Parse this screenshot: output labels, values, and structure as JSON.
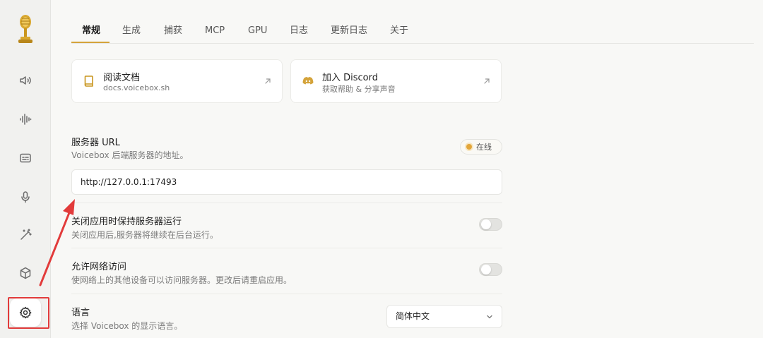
{
  "sidebar": {
    "items": [
      {
        "icon": "speaker-icon"
      },
      {
        "icon": "waveform-icon"
      },
      {
        "icon": "caption-icon"
      },
      {
        "icon": "microphone-icon"
      },
      {
        "icon": "magic-wand-icon"
      },
      {
        "icon": "cube-icon"
      },
      {
        "icon": "gear-icon",
        "active": true
      }
    ]
  },
  "tabs": [
    "常规",
    "生成",
    "捕获",
    "MCP",
    "GPU",
    "日志",
    "更新日志",
    "关于"
  ],
  "cards": [
    {
      "title": "阅读文档",
      "subtitle": "docs.voicebox.sh",
      "icon": "book-icon"
    },
    {
      "title": "加入 Discord",
      "subtitle": "获取帮助 & 分享声音",
      "icon": "discord-icon"
    }
  ],
  "server": {
    "label": "服务器 URL",
    "description": "Voicebox 后端服务器的地址。",
    "status": "在线",
    "url": "http://127.0.0.1:17493"
  },
  "keep_running": {
    "label": "关闭应用时保持服务器运行",
    "description": "关闭应用后,服务器将继续在后台运行。"
  },
  "network_access": {
    "label": "允许网络访问",
    "description": "使网络上的其他设备可以访问服务器。更改后请重启应用。"
  },
  "language": {
    "label": "语言",
    "description": "选择 Voicebox 的显示语言。",
    "selected": "简体中文"
  },
  "colors": {
    "accent": "#d4a33a",
    "annotation": "#e23b3b"
  }
}
